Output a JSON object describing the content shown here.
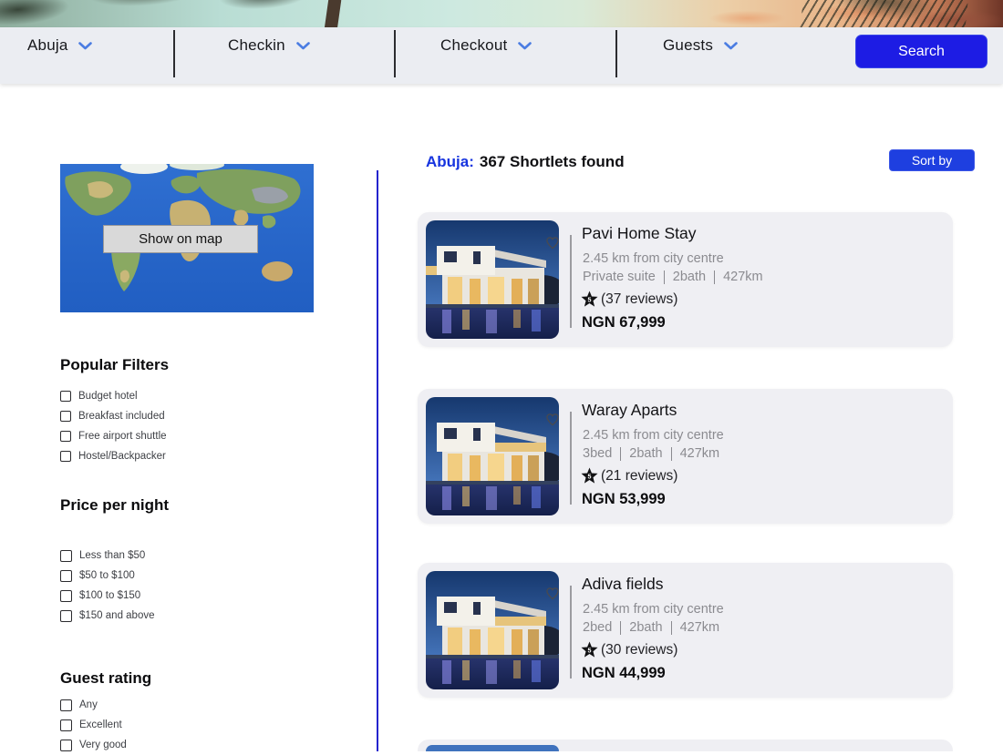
{
  "nav": {
    "items": [
      {
        "label": "Abuja"
      },
      {
        "label": "Checkin"
      },
      {
        "label": "Checkout"
      },
      {
        "label": "Guests"
      }
    ],
    "search_label": "Search"
  },
  "sidebar": {
    "map_button": "Show on map",
    "sections": [
      {
        "title": "Popular Filters",
        "options": [
          "Budget hotel",
          "Breakfast included",
          "Free airport shuttle",
          "Hostel/Backpacker"
        ]
      },
      {
        "title": "Price per night",
        "options": [
          "Less than $50",
          "$50 to $100",
          "$100 to $150",
          "$150 and above"
        ]
      },
      {
        "title": "Guest rating",
        "options": [
          "Any",
          "Excellent",
          "Very good"
        ]
      }
    ]
  },
  "results": {
    "location_label": "Abuja:",
    "count_text": "367 Shortlets found",
    "sort_button": "Sort by",
    "cards": [
      {
        "title": "Pavi Home Stay",
        "distance": "2.45 km from city centre",
        "details": [
          "Private suite",
          "2bath",
          "427km"
        ],
        "rating": "5",
        "reviews": "(37 reviews)",
        "price": "NGN 67,999"
      },
      {
        "title": "Waray Aparts",
        "distance": "2.45 km from city centre",
        "details": [
          "3bed",
          "2bath",
          "427km"
        ],
        "rating": "5",
        "reviews": "(21 reviews)",
        "price": "NGN 53,999"
      },
      {
        "title": "Adiva  fields",
        "distance": "2.45 km from city centre",
        "details": [
          "2bed",
          "2bath",
          "427km"
        ],
        "rating": "5",
        "reviews": "(30 reviews)",
        "price": "NGN 44,999"
      }
    ]
  },
  "icons": {
    "dropdown": "chevron-down",
    "favorite": "heart-outline",
    "rating": "star-with-number"
  },
  "colors": {
    "search_button": "#1d1ce4",
    "sort_button": "#1e3fe0",
    "location_text": "#1634df",
    "divider_line": "#2424ce",
    "nav_chevron": "#4b7de2",
    "navbar_bg": "#ebedf2",
    "card_bg": "#efeff3",
    "muted_text": "#8b8b90"
  }
}
